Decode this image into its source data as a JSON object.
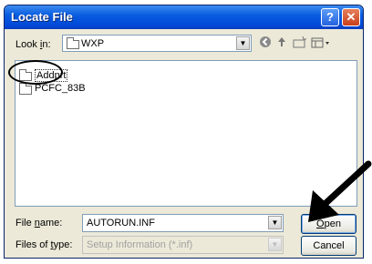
{
  "window": {
    "title": "Locate File"
  },
  "titlebar": {
    "help_label": "?",
    "close_label": "✕"
  },
  "lookin": {
    "label_pre": "Look ",
    "label_key": "i",
    "label_post": "n:",
    "value": "WXP"
  },
  "files": [
    {
      "name": "Addprt",
      "icon": "folder-icon",
      "selected": true
    },
    {
      "name": "PCFC_83B",
      "icon": "folder-icon",
      "selected": false
    }
  ],
  "filename": {
    "label_pre": "File ",
    "label_key": "n",
    "label_post": "ame:",
    "value": "AUTORUN.INF"
  },
  "filetype": {
    "label_pre": "Files of ",
    "label_key": "t",
    "label_post": "ype:",
    "value": "Setup Information (*.inf)"
  },
  "buttons": {
    "open_key": "O",
    "open_rest": "pen",
    "cancel": "Cancel"
  },
  "toolbar_icons": [
    "back-icon",
    "up-folder-icon",
    "new-folder-icon",
    "view-menu-icon"
  ]
}
